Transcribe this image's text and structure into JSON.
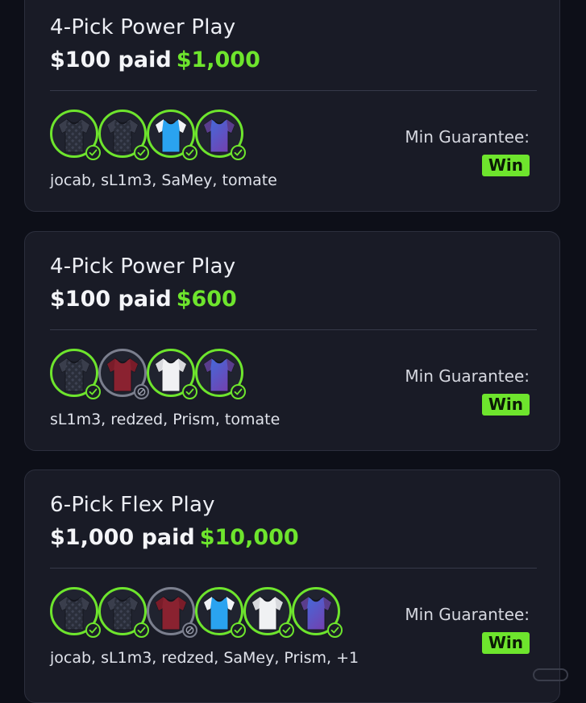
{
  "labels": {
    "min_guarantee": "Min Guarantee:"
  },
  "colors": {
    "accent_green": "#6ee52d",
    "card_bg": "#191b26",
    "page_bg": "#0d0f18",
    "void_gray": "#7b7f8e"
  },
  "entries": [
    {
      "title": "4-Pick Power Play",
      "wager": "$100 paid",
      "payout": "$1,000",
      "players": "jocab, sL1m3, SaMey, tomate",
      "guarantee": "Win",
      "picks": [
        {
          "jersey": "dark-checkered",
          "status": "hit"
        },
        {
          "jersey": "dark-checkered",
          "status": "hit"
        },
        {
          "jersey": "sky-blue",
          "status": "hit"
        },
        {
          "jersey": "purple-blue",
          "status": "hit"
        }
      ]
    },
    {
      "title": "4-Pick Power Play",
      "wager": "$100 paid",
      "payout": "$600",
      "players": "sL1m3, redzed, Prism, tomate",
      "guarantee": "Win",
      "picks": [
        {
          "jersey": "dark-checkered",
          "status": "hit"
        },
        {
          "jersey": "maroon",
          "status": "void"
        },
        {
          "jersey": "white",
          "status": "hit"
        },
        {
          "jersey": "purple-blue",
          "status": "hit"
        }
      ]
    },
    {
      "title": "6-Pick Flex Play",
      "wager": "$1,000 paid",
      "payout": "$10,000",
      "players": "jocab, sL1m3, redzed, SaMey, Prism, +1",
      "guarantee": "Win",
      "picks": [
        {
          "jersey": "dark-checkered",
          "status": "hit"
        },
        {
          "jersey": "dark-checkered",
          "status": "hit"
        },
        {
          "jersey": "maroon",
          "status": "void"
        },
        {
          "jersey": "sky-blue",
          "status": "hit"
        },
        {
          "jersey": "white",
          "status": "hit"
        },
        {
          "jersey": "purple-blue",
          "status": "hit"
        }
      ]
    }
  ]
}
